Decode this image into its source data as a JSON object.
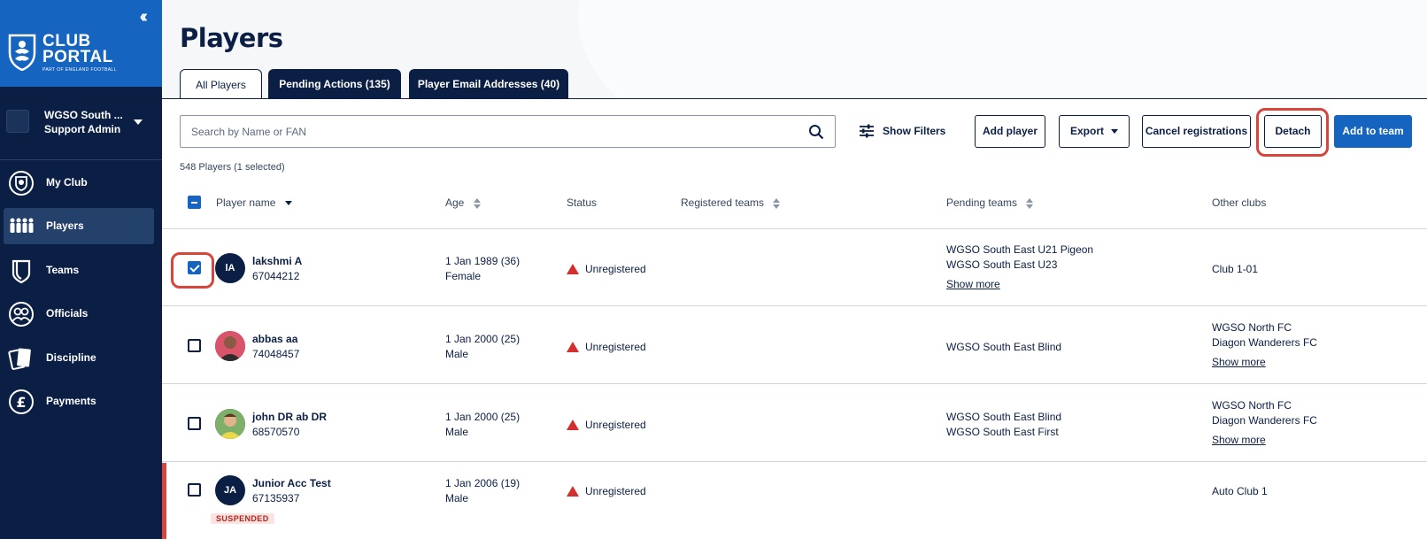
{
  "sidebar": {
    "brand_line1": "CLUB",
    "brand_line2": "PORTAL",
    "brand_sub": "PART OF ENGLAND FOOTBALL",
    "collapse_icon": "double-chevron-left-icon",
    "club_name": "WGSO South ...",
    "club_role": "Support Admin",
    "items": [
      {
        "label": "My Club",
        "icon": "shield-icon"
      },
      {
        "label": "Players",
        "icon": "players-icon"
      },
      {
        "label": "Teams",
        "icon": "teams-icon"
      },
      {
        "label": "Officials",
        "icon": "officials-icon"
      },
      {
        "label": "Discipline",
        "icon": "cards-icon"
      },
      {
        "label": "Payments",
        "icon": "pound-icon"
      }
    ],
    "active_item": "Players"
  },
  "main": {
    "title": "Players",
    "tabs": [
      {
        "label": "All Players"
      },
      {
        "label": "Pending Actions (135)"
      },
      {
        "label": "Player Email Addresses (40)"
      }
    ],
    "search": {
      "placeholder": "Search by Name or FAN",
      "value": ""
    },
    "show_filters": "Show Filters",
    "buttons": {
      "add_player": "Add player",
      "export": "Export",
      "cancel_registrations": "Cancel registrations",
      "detach": "Detach",
      "add_to_team": "Add to team"
    },
    "count": "548 Players (1 selected)",
    "columns": {
      "player_name": "Player name",
      "age": "Age",
      "status": "Status",
      "registered_teams": "Registered teams",
      "pending_teams": "Pending teams",
      "other_clubs": "Other clubs"
    },
    "rows": [
      {
        "initials": "lA",
        "name": "lakshmi A",
        "fan": "67044212",
        "dob": "1 Jan 1989 (36)",
        "gender": "Female",
        "status": "Unregistered",
        "pending": [
          "WGSO South East U21 Pigeon",
          "WGSO South East U23"
        ],
        "pending_more": "Show more",
        "other": [
          "Club 1-01"
        ],
        "other_more": "",
        "checked": true
      },
      {
        "initials": "",
        "name": "abbas aa",
        "fan": "74048457",
        "dob": "1 Jan 2000 (25)",
        "gender": "Male",
        "status": "Unregistered",
        "pending": [
          "WGSO South East Blind"
        ],
        "pending_more": "",
        "other": [
          "WGSO North FC",
          "Diagon Wanderers FC"
        ],
        "other_more": "Show more",
        "checked": false
      },
      {
        "initials": "",
        "name": "john DR ab DR",
        "fan": "68570570",
        "dob": "1 Jan 2000 (25)",
        "gender": "Male",
        "status": "Unregistered",
        "pending": [
          "WGSO South East Blind",
          "WGSO South East First"
        ],
        "pending_more": "",
        "other": [
          "WGSO North FC",
          "Diagon Wanderers FC"
        ],
        "other_more": "Show more",
        "checked": false
      },
      {
        "initials": "JA",
        "name": "Junior Acc Test",
        "fan": "67135937",
        "dob": "1 Jan 2006 (19)",
        "gender": "Male",
        "status": "Unregistered",
        "pending": [],
        "pending_more": "",
        "other": [
          "Auto Club 1"
        ],
        "other_more": "",
        "badge": "SUSPENDED",
        "checked": false
      }
    ]
  },
  "colors": {
    "navy": "#0b1f45",
    "brand_blue": "#1565c0",
    "highlight_red": "#d8453a",
    "warning_red": "#d32f2f"
  }
}
